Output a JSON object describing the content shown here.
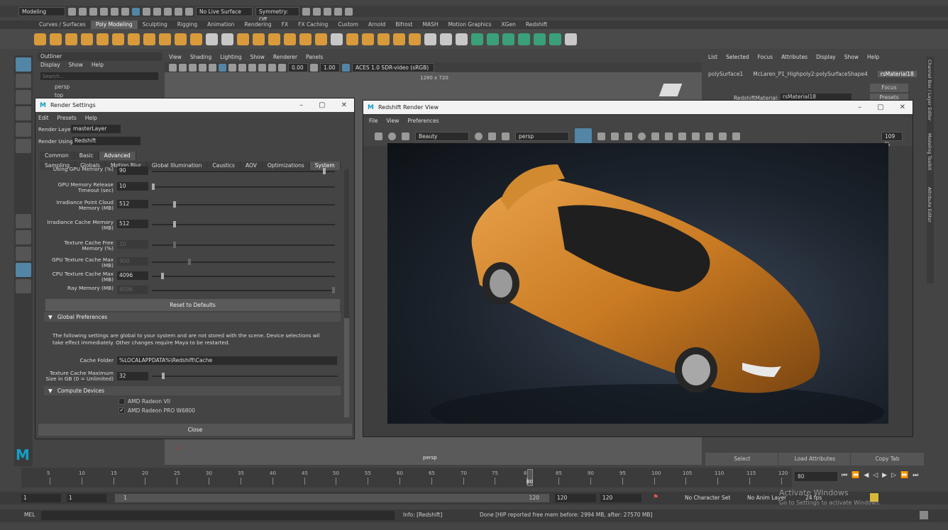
{
  "statusline": {
    "workspace": "Modeling",
    "live_surface": "No Live Surface",
    "symmetry": "Symmetry: Off"
  },
  "shelf_tabs": [
    "Curves / Surfaces",
    "Poly Modeling",
    "Sculpting",
    "Rigging",
    "Animation",
    "Rendering",
    "FX",
    "FX Caching",
    "Custom",
    "Arnold",
    "Bifrost",
    "MASH",
    "Motion Graphics",
    "XGen",
    "Redshift"
  ],
  "outliner": {
    "title": "Outliner",
    "menu": [
      "Display",
      "Show",
      "Help"
    ],
    "search_placeholder": "Search...",
    "items": [
      "persp",
      "top"
    ]
  },
  "viewport": {
    "menu": [
      "View",
      "Shading",
      "Lighting",
      "Show",
      "Renderer",
      "Panels"
    ],
    "value_a": "0.00",
    "value_b": "1.00",
    "colorspace": "ACES 1.0 SDR-video (sRGB)",
    "resolution": "1280 x 720",
    "camera_label": "persp"
  },
  "channelbox": {
    "menu": [
      "List",
      "Selected",
      "Focus",
      "Attributes",
      "Display",
      "Show",
      "Help"
    ],
    "tabs": [
      "polySurface1",
      "McLaren_P1_Highpoly2:polySurfaceShape4",
      "rsMaterial18"
    ],
    "attr_label": "RedshiftMaterial:",
    "attr_value": "rsMaterial18",
    "focus_btn": "Focus",
    "presets_btn": "Presets",
    "bottom_buttons": [
      "Select",
      "Load Attributes",
      "Copy Tab"
    ],
    "side_tabs": [
      "Channel Box / Layer Editor",
      "Modeling Toolkit",
      "Attribute Editor"
    ]
  },
  "render_settings": {
    "title": "Render Settings",
    "menu": [
      "Edit",
      "Presets",
      "Help"
    ],
    "render_layer_label": "Render Layer",
    "render_layer_value": "masterLayer",
    "render_using_label": "Render Using",
    "render_using_value": "Redshift",
    "tabs": [
      "Common",
      "Basic",
      "Advanced"
    ],
    "subtabs": [
      "Sampling",
      "Globals",
      "Motion Blur",
      "Global Illumination",
      "Caustics",
      "AOV",
      "Optimizations",
      "System"
    ],
    "fields": [
      {
        "label": "Using GPU Memory (%)",
        "value": "90",
        "dim": false,
        "level": 0.95
      },
      {
        "label": "GPU Memory Release Timeout (sec)",
        "value": "10",
        "dim": false,
        "level": 0.0
      },
      {
        "label": "Irradiance Point Cloud Memory (MB)",
        "value": "512",
        "dim": false,
        "level": 0.12
      },
      {
        "label": "Irradiance Cache Memory (MB)",
        "value": "512",
        "dim": false,
        "level": 0.12
      },
      {
        "label": "Texture Cache Free Memory (%)",
        "value": "20",
        "dim": true,
        "level": 0.12
      },
      {
        "label": "GPU Texture Cache Max (MB)",
        "value": "900",
        "dim": true,
        "level": 0.2
      },
      {
        "label": "CPU Texture Cache Max (MB)",
        "value": "4096",
        "dim": false,
        "level": 0.05
      },
      {
        "label": "Ray Memory (MB)",
        "value": "4096",
        "dim": true,
        "level": 1.0
      }
    ],
    "reset_button": "Reset to Defaults",
    "global_prefs_header": "Global Preferences",
    "global_prefs_note": "The following settings are global to your system and are not stored with the scene. Device selections wil take effect immediately. Other changes require Maya to be restarted.",
    "cache_folder_label": "Cache Folder",
    "cache_folder_value": "%LOCALAPPDATA%\\Redshift\\Cache",
    "texcache_label": "Texture Cache Maximum Size in GB (0 = Unlimited)",
    "texcache_value": "32",
    "compute_devices_header": "Compute Devices",
    "devices": [
      {
        "name": "AMD Radeon VII",
        "checked": false
      },
      {
        "name": "AMD Radeon PRO W6800",
        "checked": true
      }
    ],
    "close_button": "Close"
  },
  "render_view": {
    "title": "Redshift Render View",
    "menu": [
      "File",
      "View",
      "Preferences"
    ],
    "aov": "Beauty",
    "camera": "persp",
    "zoom": "109 %"
  },
  "timeline": {
    "ticks": [
      "5",
      "10",
      "15",
      "20",
      "25",
      "30",
      "35",
      "40",
      "45",
      "50",
      "55",
      "60",
      "65",
      "70",
      "75",
      "80",
      "85",
      "90",
      "95",
      "100",
      "105",
      "110",
      "115",
      "120"
    ],
    "current_frame": "80",
    "frame_field": "80"
  },
  "range": {
    "start": "1",
    "start2": "1",
    "slider_start": "1",
    "slider_end": "120",
    "end": "120",
    "end2": "120",
    "character_set": "No Character Set",
    "anim_layer": "No Anim Layer",
    "fps": "24 fps"
  },
  "cmdline": {
    "mel_label": "MEL",
    "info": "Info: [Redshift]",
    "message": "Done [HIP reported free mem before: 2994 MB, after: 27570 MB]"
  },
  "watermark": {
    "line1": "Activate Windows",
    "line2": "Go to Settings to activate Windows."
  }
}
